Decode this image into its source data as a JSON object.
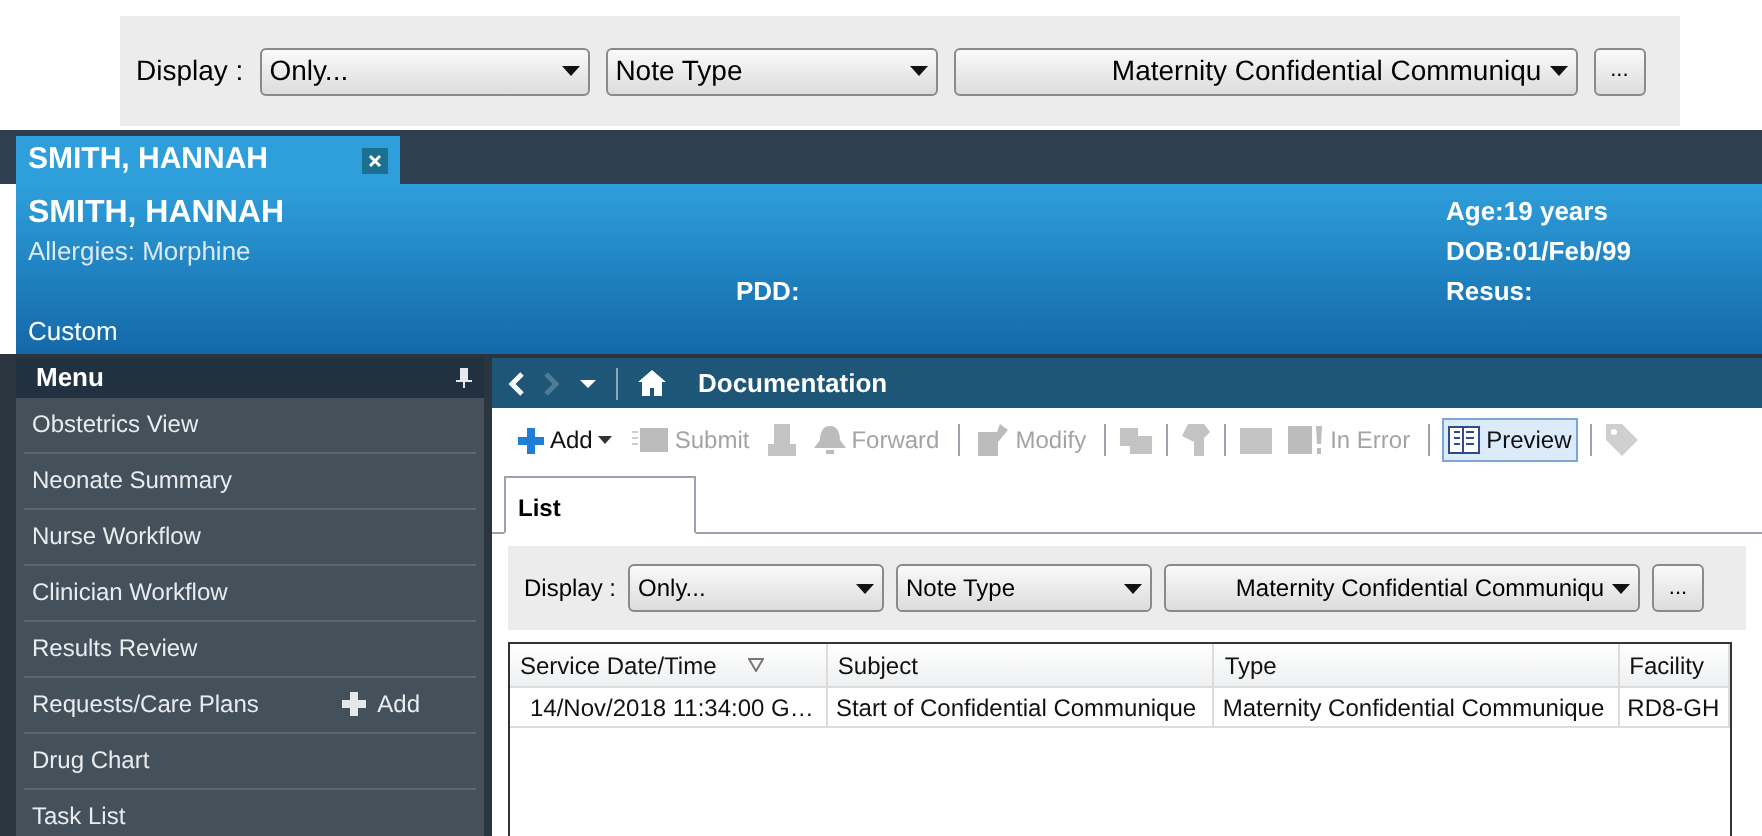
{
  "top_filter": {
    "label": "Display :",
    "dropdowns": [
      {
        "value": "Only..."
      },
      {
        "value": "Note Type"
      },
      {
        "value": "Maternity Confidential Communiqu"
      }
    ],
    "more_button": "..."
  },
  "patient_tab": {
    "label": "SMITH, HANNAH",
    "selected": true
  },
  "banner": {
    "name": "SMITH, HANNAH",
    "allergies": "Allergies: Morphine",
    "pdd": "PDD:",
    "age": "Age:19 years",
    "dob": "DOB:01/Feb/99",
    "resus": "Resus:",
    "custom": "Custom"
  },
  "menu": {
    "title": "Menu",
    "items": [
      {
        "label": "Obstetrics View"
      },
      {
        "label": "Neonate Summary"
      },
      {
        "label": "Nurse Workflow"
      },
      {
        "label": "Clinician Workflow"
      },
      {
        "label": "Results Review"
      },
      {
        "label": "Requests/Care Plans",
        "action": "Add"
      },
      {
        "label": "Drug Chart"
      },
      {
        "label": "Task List"
      }
    ]
  },
  "page": {
    "title": "Documentation"
  },
  "toolbar": [
    {
      "kind": "button",
      "label": "Add",
      "disabled": false,
      "selected": false,
      "caret": true
    },
    {
      "kind": "button",
      "label": "Submit",
      "disabled": true,
      "selected": false
    },
    {
      "kind": "icon",
      "disabled": true
    },
    {
      "kind": "button",
      "label": "Forward",
      "disabled": true,
      "selected": false
    },
    {
      "kind": "separator"
    },
    {
      "kind": "button",
      "label": "Modify",
      "disabled": true,
      "selected": false
    },
    {
      "kind": "separator"
    },
    {
      "kind": "icon",
      "disabled": true
    },
    {
      "kind": "separator"
    },
    {
      "kind": "icon",
      "disabled": true
    },
    {
      "kind": "separator"
    },
    {
      "kind": "icon",
      "disabled": true
    },
    {
      "kind": "button",
      "label": "In Error",
      "disabled": true,
      "selected": false
    },
    {
      "kind": "separator"
    },
    {
      "kind": "button",
      "label": "Preview",
      "disabled": false,
      "selected": true
    },
    {
      "kind": "separator"
    },
    {
      "kind": "icon",
      "disabled": true
    }
  ],
  "tabs": [
    {
      "label": "List",
      "selected": true
    }
  ],
  "filter": {
    "label": "Display :",
    "dropdowns": [
      {
        "value": "Only..."
      },
      {
        "value": "Note Type"
      },
      {
        "value": "Maternity Confidential Communiqu"
      }
    ],
    "more_button": "..."
  },
  "table": {
    "columns": [
      {
        "label": "Service Date/Time",
        "sorted": true
      },
      {
        "label": "Subject",
        "sorted": false
      },
      {
        "label": "Type",
        "sorted": false
      },
      {
        "label": "Facility",
        "sorted": false
      }
    ],
    "rows": [
      [
        "14/Nov/2018 11:34:00 G…",
        "Start of Confidential Communique",
        "Maternity Confidential Communique",
        "RD8-GH"
      ]
    ]
  }
}
